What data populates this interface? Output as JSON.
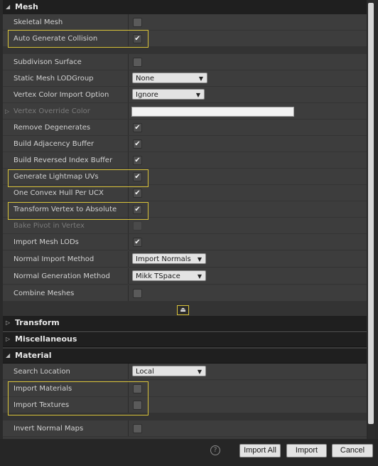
{
  "sections": {
    "mesh": {
      "title": "Mesh",
      "arrow": "◢"
    },
    "transform": {
      "title": "Transform",
      "arrow": "▷"
    },
    "miscellaneous": {
      "title": "Miscellaneous",
      "arrow": "▷"
    },
    "material": {
      "title": "Material",
      "arrow": "◢"
    }
  },
  "mesh_rows": {
    "skeletal_mesh": {
      "label": "Skeletal Mesh",
      "checked": false
    },
    "auto_generate_collision": {
      "label": "Auto Generate Collision",
      "checked": true
    },
    "subdivison_surface": {
      "label": "Subdivison Surface",
      "checked": false
    },
    "static_mesh_lodgroup": {
      "label": "Static Mesh LODGroup",
      "value": "None"
    },
    "vertex_color_import_option": {
      "label": "Vertex Color Import Option",
      "value": "Ignore"
    },
    "vertex_override_color": {
      "label": "Vertex Override Color",
      "expander": "▷"
    },
    "remove_degenerates": {
      "label": "Remove Degenerates",
      "checked": true
    },
    "build_adjacency_buffer": {
      "label": "Build Adjacency Buffer",
      "checked": true
    },
    "build_reversed_index_buffer": {
      "label": "Build Reversed Index Buffer",
      "checked": true
    },
    "generate_lightmap_uvs": {
      "label": "Generate Lightmap UVs",
      "checked": true
    },
    "one_convex_hull_per_ucx": {
      "label": "One Convex Hull Per UCX",
      "checked": true
    },
    "transform_vertex_to_absolute": {
      "label": "Transform Vertex to Absolute",
      "checked": true
    },
    "bake_pivot_in_vertex": {
      "label": "Bake Pivot in Vertex",
      "checked": false
    },
    "import_mesh_lods": {
      "label": "Import Mesh LODs",
      "checked": true
    },
    "normal_import_method": {
      "label": "Normal Import Method",
      "value": "Import Normals"
    },
    "normal_generation_method": {
      "label": "Normal Generation Method",
      "value": "Mikk TSpace"
    },
    "combine_meshes": {
      "label": "Combine Meshes",
      "checked": false
    }
  },
  "material_rows": {
    "search_location": {
      "label": "Search Location",
      "value": "Local"
    },
    "import_materials": {
      "label": "Import Materials",
      "checked": false
    },
    "import_textures": {
      "label": "Import Textures",
      "checked": false
    },
    "invert_normal_maps": {
      "label": "Invert Normal Maps",
      "checked": false
    }
  },
  "icons": {
    "check": "✔",
    "caret": "▼",
    "collapse": "⏏",
    "help": "?"
  },
  "footer": {
    "import_all": "Import All",
    "import": "Import",
    "cancel": "Cancel"
  },
  "colors": {
    "highlight": "#d9c33a",
    "panel": "#3b3b3b",
    "header": "#1f1f1f"
  }
}
